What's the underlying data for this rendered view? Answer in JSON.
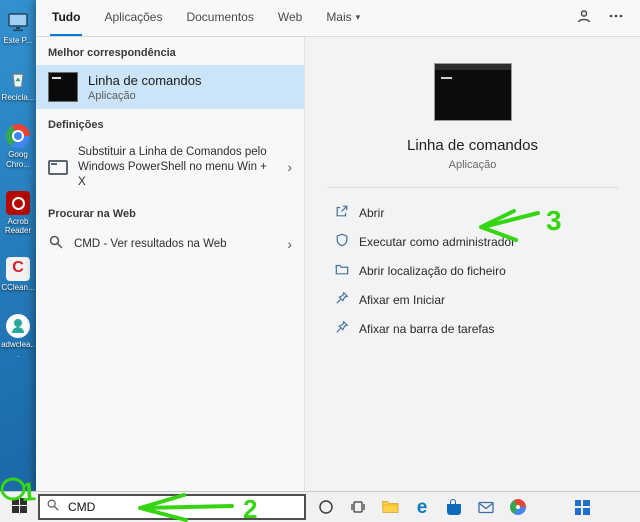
{
  "search_panel": {
    "tabs": [
      {
        "label": "Tudo",
        "active": true
      },
      {
        "label": "Aplicações",
        "active": false
      },
      {
        "label": "Documentos",
        "active": false
      },
      {
        "label": "Web",
        "active": false
      },
      {
        "label": "Mais",
        "active": false,
        "has_dropdown": true
      }
    ],
    "sections": {
      "best_match_header": "Melhor correspondência",
      "settings_header": "Definições",
      "web_header": "Procurar na Web"
    },
    "best_match": {
      "title": "Linha de comandos",
      "subtitle": "Aplicação"
    },
    "settings_item": {
      "label": "Substituir a Linha de Comandos pelo Windows PowerShell no menu Win + X",
      "icon": "settings-window-icon"
    },
    "web_item": {
      "label": "CMD - Ver resultados na Web",
      "icon": "search-icon"
    },
    "header_icon_names": [
      "user-icon",
      "ellipsis-icon"
    ],
    "preview": {
      "title": "Linha de comandos",
      "subtitle": "Aplicação",
      "actions": [
        {
          "label": "Abrir",
          "icon": "open-icon"
        },
        {
          "label": "Executar como administrador",
          "icon": "run-as-admin-icon"
        },
        {
          "label": "Abrir localização do ficheiro",
          "icon": "open-file-location-icon"
        },
        {
          "label": "Afixar em Iniciar",
          "icon": "pin-to-start-icon"
        },
        {
          "label": "Afixar na barra de tarefas",
          "icon": "pin-to-taskbar-icon"
        }
      ]
    }
  },
  "desktop": {
    "icons": [
      {
        "name": "this-pc",
        "label": "Este P..."
      },
      {
        "name": "recycle-bin",
        "label": "Recicla..."
      },
      {
        "name": "google-chrome",
        "label": "Goog Chro..."
      },
      {
        "name": "acrobat-reader",
        "label": "Acrob Reader"
      },
      {
        "name": "ccleaner",
        "label": "CClean..."
      },
      {
        "name": "adwcleaner",
        "label": "adwclea..."
      }
    ]
  },
  "taskbar": {
    "search_value": "CMD",
    "icon_names": [
      "start",
      "cortana",
      "task-view",
      "file-explorer",
      "edge",
      "store",
      "mail",
      "chrome",
      "app-tiles"
    ]
  },
  "annotations": {
    "color": "#36d512",
    "steps": {
      "one": "1",
      "two": "2",
      "three": "3"
    },
    "step3_target": "Executar como administrador",
    "step2_target": "taskbar search box",
    "step1_target": "start button"
  },
  "colors": {
    "accent": "#0078d7",
    "selection": "#cce4f7",
    "desktop_top": "#3391d0",
    "desktop_bottom": "#15598f",
    "taskbar_bg": "#f1f1f1"
  }
}
